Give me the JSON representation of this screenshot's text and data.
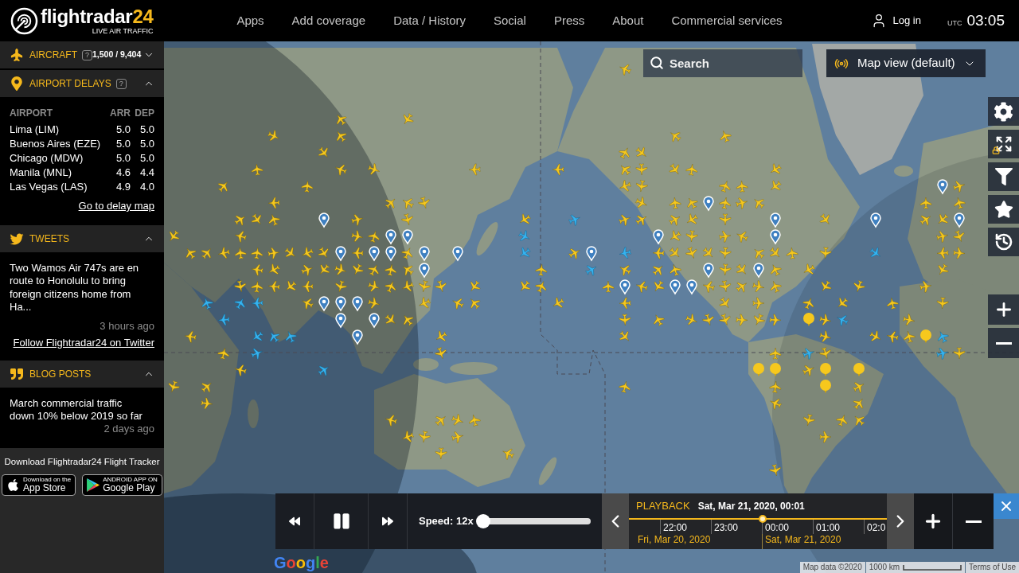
{
  "header": {
    "logo": {
      "wordmark": "flightradar",
      "accent": "24",
      "tagline": "LIVE AIR TRAFFIC"
    },
    "nav": [
      {
        "label": "Apps"
      },
      {
        "label": "Add coverage"
      },
      {
        "label": "Data / History"
      },
      {
        "label": "Social"
      },
      {
        "label": "Press"
      },
      {
        "label": "About"
      },
      {
        "label": "Commercial services"
      }
    ],
    "login": "Log in",
    "clock": {
      "zone": "UTC",
      "time": "03:05"
    }
  },
  "sidebar": {
    "sections": [
      {
        "kind": "aircraft",
        "title": "AIRCRAFT",
        "help": "?",
        "count": "1,500 / 9,404",
        "expanded": false
      },
      {
        "kind": "delays",
        "title": "AIRPORT DELAYS",
        "help": "?",
        "expanded": true,
        "columns": [
          "AIRPORT",
          "ARR",
          "DEP"
        ],
        "rows": [
          {
            "cells": [
              "Lima (LIM)",
              "5.0",
              "5.0"
            ]
          },
          {
            "cells": [
              "Buenos Aires (EZE)",
              "5.0",
              "5.0"
            ]
          },
          {
            "cells": [
              "Chicago (MDW)",
              "5.0",
              "5.0"
            ]
          },
          {
            "cells": [
              "Manila (MNL)",
              "4.6",
              "4.4"
            ]
          },
          {
            "cells": [
              "Las Vegas (LAS)",
              "4.9",
              "4.0"
            ]
          }
        ],
        "link": "Go to delay map"
      },
      {
        "kind": "tweets",
        "title": "TWEETS",
        "expanded": true,
        "text": "Two Wamos Air 747s are en route to Honolulu to bring foreign citizens home from Ha...",
        "time": "3 hours ago",
        "link": "Follow Flightradar24 on Twitter"
      },
      {
        "kind": "blog",
        "title": "BLOG POSTS",
        "expanded": true,
        "text": "March commercial traffic down 10% below 2019 so far",
        "time": "2 days ago"
      }
    ],
    "download": {
      "title": "Download Flightradar24 Flight Tracker",
      "badges": [
        {
          "kind": "apple",
          "small": "Download on the",
          "big": "App Store"
        },
        {
          "kind": "google",
          "small": "ANDROID APP ON",
          "big": "Google Play"
        }
      ]
    }
  },
  "map": {
    "search": {
      "placeholder": "Search"
    },
    "view_menu": {
      "label": "Map view (default)",
      "expanded": false
    }
  },
  "playback": {
    "playing": true,
    "speed": {
      "label": "Speed: 12x",
      "level": 0.01
    },
    "title": "PLAYBACK",
    "datetime": "Sat, Mar 21, 2020, 00:01",
    "playhead": {
      "level": 0.52
    },
    "ticks": [
      {
        "label": "22:00"
      },
      {
        "label": "23:00"
      },
      {
        "label": "00:00"
      },
      {
        "label": "01:00"
      },
      {
        "label": "02:0"
      }
    ],
    "dates": [
      {
        "label": "Fri, Mar 20, 2020"
      },
      {
        "label": "Sat, Mar 21, 2020"
      }
    ]
  },
  "map_footer": {
    "google_logo": "Google",
    "map_data": "Map data ©2020",
    "scale": "1000 km",
    "terms": "Terms of Use"
  }
}
